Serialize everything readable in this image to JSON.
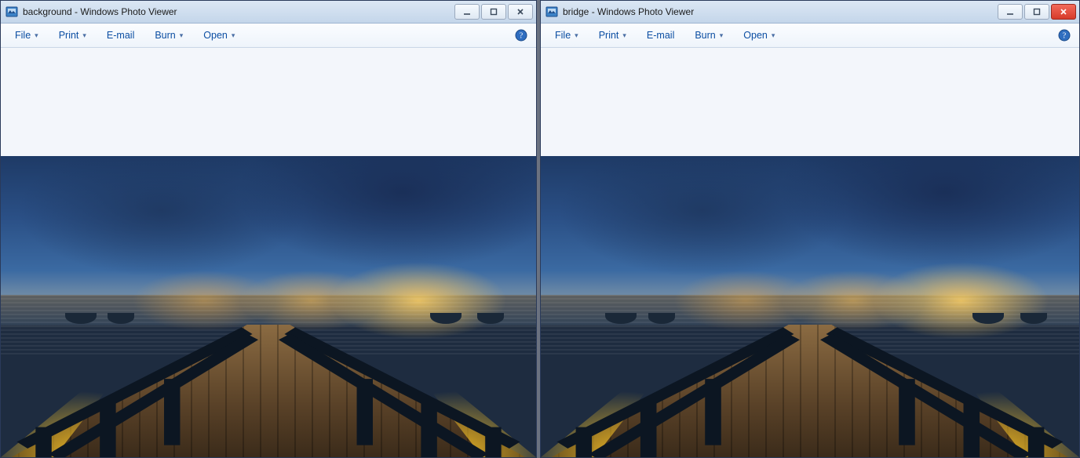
{
  "windows": [
    {
      "key": "left",
      "title": "background - Windows Photo Viewer",
      "controls": {
        "min": "–",
        "max": "❐",
        "close": "✕"
      },
      "close_style": "normal",
      "menu": {
        "file": "File",
        "print": "Print",
        "email": "E-mail",
        "burn": "Burn",
        "open": "Open"
      }
    },
    {
      "key": "right",
      "title": "bridge - Windows Photo Viewer",
      "controls": {
        "min": "–",
        "max": "❐",
        "close": "✕"
      },
      "close_style": "danger",
      "menu": {
        "file": "File",
        "print": "Print",
        "email": "E-mail",
        "burn": "Burn",
        "open": "Open"
      }
    }
  ]
}
